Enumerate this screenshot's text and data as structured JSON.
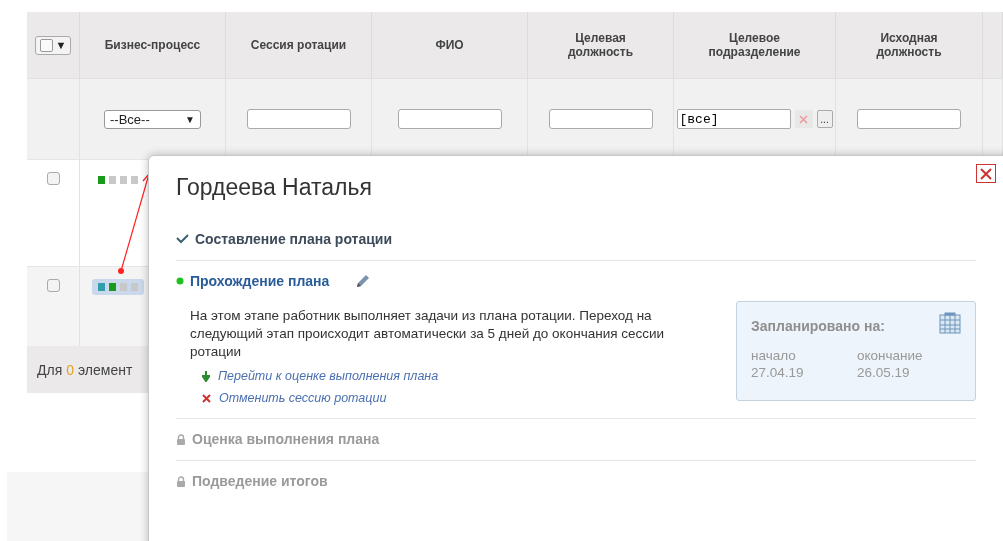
{
  "table": {
    "select_all": {
      "checked": false,
      "caret": "▼"
    },
    "columns": [
      "Бизнес-процесс",
      "Сессия ротации",
      "ФИО",
      "Целевая должность",
      "Целевое подразделение",
      "Исходная должность"
    ],
    "filters": [
      {
        "kind": "select",
        "value": "--Все--",
        "caret": "▼"
      },
      {
        "kind": "input"
      },
      {
        "kind": "input"
      },
      {
        "kind": "input"
      },
      {
        "kind": "picker",
        "value": "[все]",
        "more": "..."
      },
      {
        "kind": "input"
      }
    ],
    "rows": [
      {
        "checked": false,
        "highlighted": false,
        "stages": [
          {
            "color": "#1a9a1a"
          },
          {
            "color": "#c8c8c8"
          },
          {
            "color": "#c8c8c8"
          },
          {
            "color": "#c8c8c8"
          }
        ]
      },
      {
        "checked": false,
        "highlighted": true,
        "stages": [
          {
            "color": "#2f9fb0"
          },
          {
            "color": "#1a9a1a"
          },
          {
            "color": "#c8c8c8"
          },
          {
            "color": "#c8c8c8"
          }
        ]
      }
    ],
    "footer": {
      "prefix": "Для",
      "count": "0",
      "suffix": "элемент"
    }
  },
  "popup": {
    "title": "Гордеева Наталья",
    "steps": [
      {
        "kind": "done",
        "label": "Составление плана ротации"
      },
      {
        "kind": "current",
        "label": "Прохождение плана",
        "description": "На этом этапе работник выполняет задачи из плана ротации. Переход на следующий этап происходит автоматически за 5 дней до окончания сессии ротации",
        "actions": [
          {
            "kind": "next",
            "label": "Перейти к оценке выполнения плана"
          },
          {
            "kind": "cancel",
            "label": "Отменить сессию ротации"
          }
        ],
        "schedule": {
          "title": "Запланировано на:",
          "start_label": "начало",
          "start": "27.04.19",
          "end_label": "окончание",
          "end": "26.05.19"
        }
      },
      {
        "kind": "locked",
        "label": "Оценка выполнения плана"
      },
      {
        "kind": "locked",
        "label": "Подведение итогов"
      }
    ]
  }
}
